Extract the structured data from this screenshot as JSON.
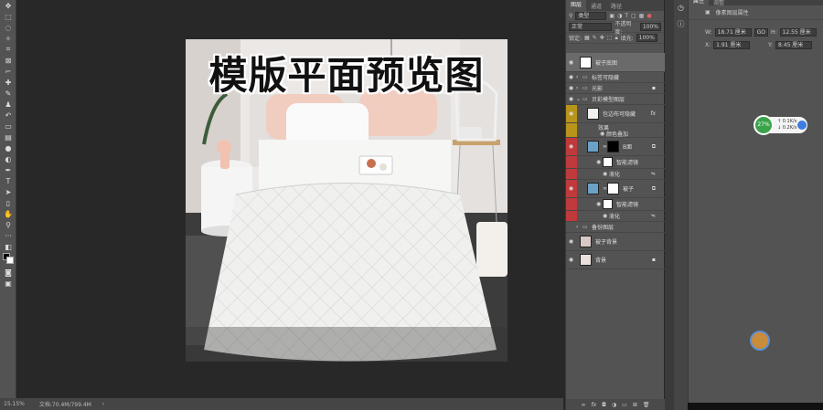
{
  "document": {
    "overlay_title": "模版平面预览图"
  },
  "status_bar": {
    "zoom": "15.15%",
    "doc_info": "文档:70.4M/799.4M"
  },
  "layers_panel": {
    "tabs": [
      "图层",
      "通道",
      "路径"
    ],
    "filter_label": "类型",
    "blend_mode": "正常",
    "opacity_label": "不透明度:",
    "opacity_value": "100%",
    "lock_label": "锁定:",
    "fill_label": "填充:",
    "fill_value": "100%",
    "layers": [
      {
        "name": "被子底图"
      },
      {
        "name": "标签可隐藏"
      },
      {
        "name": "光影"
      },
      {
        "name": "贝彩模型图层"
      },
      {
        "name": "包边布可隐藏"
      },
      {
        "name": "效果"
      },
      {
        "name": "颜色叠加"
      },
      {
        "name": "B面"
      },
      {
        "name": "智能滤镜"
      },
      {
        "name": "液化"
      },
      {
        "name": "被子"
      },
      {
        "name": "智能滤镜"
      },
      {
        "name": "液化"
      },
      {
        "name": "备份图层"
      },
      {
        "name": "被子背景"
      },
      {
        "name": "背景"
      }
    ]
  },
  "properties_panel": {
    "tabs": [
      "属性",
      "调整"
    ],
    "title": "像素图层属性",
    "w_label": "W:",
    "w_value": "18.71 厘米",
    "go_label": "GO",
    "h_label": "H:",
    "h_value": "12.55 厘米",
    "x_label": "X:",
    "x_value": "1.91 厘米",
    "y_label": "Y:",
    "y_value": "8.45 厘米"
  },
  "net_widget": {
    "percent": "27%",
    "up": "0.1K/s",
    "down": "0.2K/s"
  },
  "colors": {
    "accent_gold": "#b8951a",
    "accent_red": "#c0393b",
    "widget_green": "#3ba34a"
  }
}
